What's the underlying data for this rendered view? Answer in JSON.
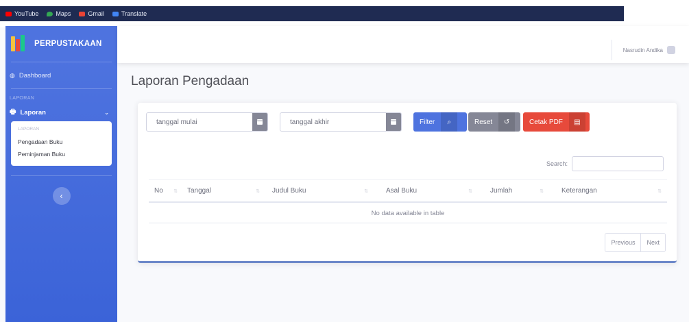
{
  "bookmarks": [
    {
      "label": "YouTube",
      "color": "#ff0000"
    },
    {
      "label": "Maps",
      "color": "#34a853"
    },
    {
      "label": "Gmail",
      "color": "#ea4335"
    },
    {
      "label": "Translate",
      "color": "#4285f4"
    }
  ],
  "sidebar": {
    "brand": "PERPUSTAKAAN",
    "dashboard": "Dashboard",
    "section_heading": "LAPORAN",
    "laporan_label": "Laporan",
    "submenu_heading": "LAPORAN",
    "submenu": [
      "Pengadaan Buku",
      "Peminjaman Buku"
    ]
  },
  "topbar": {
    "username": "Nasrudin Andika"
  },
  "page": {
    "title": "Laporan Pengadaan"
  },
  "filters": {
    "start_placeholder": "tanggal mulai",
    "end_placeholder": "tanggal akhir",
    "filter_label": "Filter",
    "reset_label": "Reset",
    "pdf_label": "Cetak PDF"
  },
  "table": {
    "search_label": "Search:",
    "columns": [
      "No",
      "Tanggal",
      "Judul Buku",
      "Asal Buku",
      "Jumlah",
      "Keterangan"
    ],
    "empty_message": "No data available in table",
    "prev_label": "Previous",
    "next_label": "Next"
  },
  "colors": {
    "primary": "#4e73df",
    "secondary": "#858796",
    "danger": "#e74a3b"
  }
}
